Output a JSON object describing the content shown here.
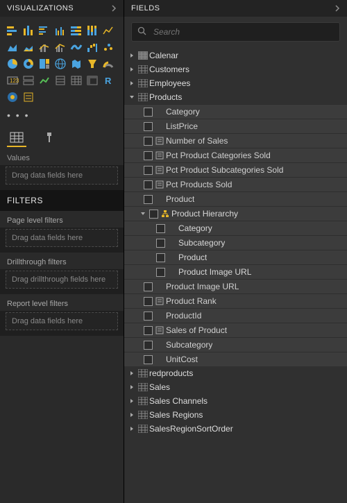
{
  "viz": {
    "title": "VISUALIZATIONS",
    "dots": "• • •",
    "values_label": "Values",
    "values_placeholder": "Drag data fields here"
  },
  "filters": {
    "title": "FILTERS",
    "page_label": "Page level filters",
    "page_placeholder": "Drag data fields here",
    "drill_label": "Drillthrough filters",
    "drill_placeholder": "Drag drillthrough fields here",
    "report_label": "Report level filters",
    "report_placeholder": "Drag data fields here"
  },
  "fields": {
    "title": "FIELDS",
    "search_placeholder": "Search",
    "tables": {
      "calenar": "Calenar",
      "customers": "Customers",
      "employees": "Employees",
      "products": "Products",
      "redproducts": "redproducts",
      "sales": "Sales",
      "sales_channels": "Sales Channels",
      "sales_regions": "Sales Regions",
      "sales_region_sort": "SalesRegionSortOrder"
    },
    "products_fields": {
      "category": "Category",
      "list_price": "ListPrice",
      "num_sales": "Number of Sales",
      "pct_cat": "Pct Product Categories Sold",
      "pct_subcat": "Pct Product Subcategories Sold",
      "pct_prod": "Pct Products Sold",
      "product": "Product",
      "hierarchy": "Product Hierarchy",
      "h_category": "Category",
      "h_subcategory": "Subcategory",
      "h_product": "Product",
      "h_img": "Product Image URL",
      "img_url": "Product Image URL",
      "rank": "Product Rank",
      "product_id": "ProductId",
      "sales_of": "Sales of Product",
      "subcategory": "Subcategory",
      "unit_cost": "UnitCost"
    }
  }
}
